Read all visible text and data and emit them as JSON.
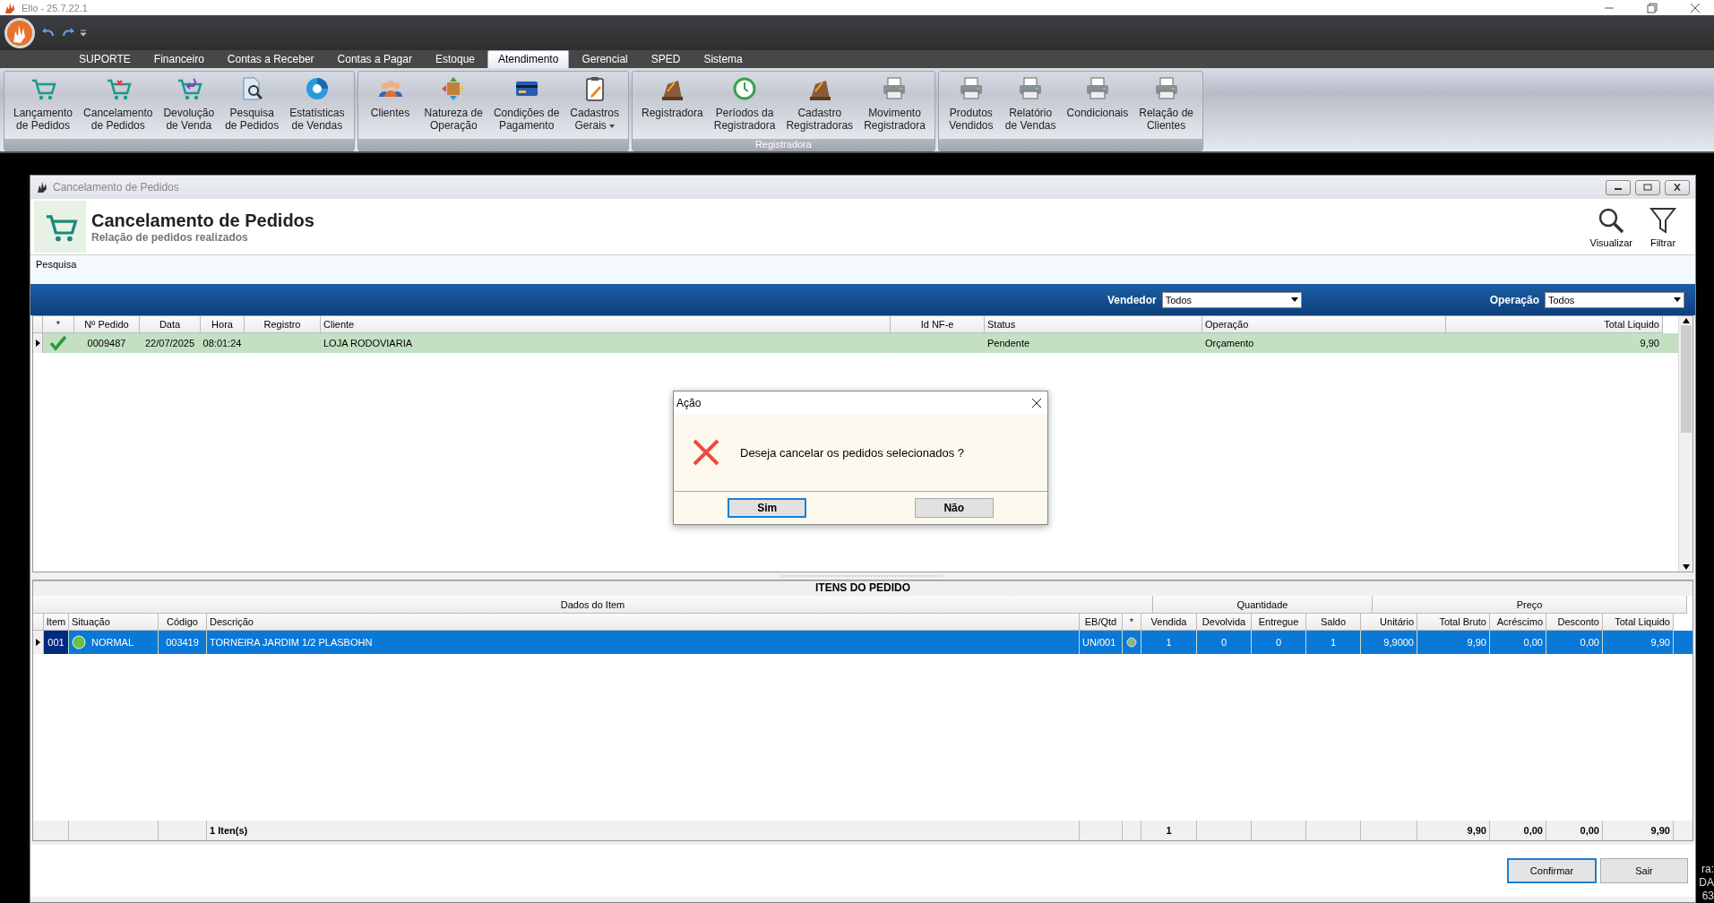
{
  "app_title": "Ello - 25.7.22.1",
  "ribbon_tabs": [
    {
      "label": "SUPORTE",
      "selected": false
    },
    {
      "label": "Financeiro",
      "selected": false
    },
    {
      "label": "Contas a Receber",
      "selected": false
    },
    {
      "label": "Contas a Pagar",
      "selected": false
    },
    {
      "label": "Estoque",
      "selected": false
    },
    {
      "label": "Atendimento",
      "selected": true
    },
    {
      "label": "Gerencial",
      "selected": false
    },
    {
      "label": "SPED",
      "selected": false
    },
    {
      "label": "Sistema",
      "selected": false
    }
  ],
  "ribbon_groups": [
    {
      "buttons": [
        {
          "label": "Lançamento\nde Pedidos"
        },
        {
          "label": "Cancelamento\nde Pedidos"
        },
        {
          "label": "Devolução\nde Venda"
        },
        {
          "label": "Pesquisa\nde Pedidos"
        },
        {
          "label": "Estatísticas\nde Vendas"
        }
      ]
    },
    {
      "buttons": [
        {
          "label": "Clientes"
        },
        {
          "label": "Natureza de\nOperação"
        },
        {
          "label": "Condições de\nPagamento"
        },
        {
          "label": "Cadastros\nGerais",
          "has_menu": true
        }
      ]
    },
    {
      "label": "Registradora",
      "buttons": [
        {
          "label": "Registradora"
        },
        {
          "label": "Períodos da\nRegistradora"
        },
        {
          "label": "Cadastro\nRegistradoras"
        },
        {
          "label": "Movimento\nRegistradora"
        }
      ]
    },
    {
      "buttons": [
        {
          "label": "Produtos\nVendidos"
        },
        {
          "label": "Relatório\nde Vendas"
        },
        {
          "label": "Condicionais"
        },
        {
          "label": "Relação de\nClientes"
        }
      ]
    }
  ],
  "window": {
    "title": "Cancelamento de Pedidos",
    "heading": "Cancelamento de Pedidos",
    "subheading": "Relação de pedidos realizados",
    "actions": [
      {
        "label": "Visualizar"
      },
      {
        "label": "Filtrar"
      }
    ]
  },
  "search_label": "Pesquisa",
  "filters": [
    {
      "label": "Vendedor",
      "value": "Todos"
    },
    {
      "label": "Operação",
      "value": "Todos"
    }
  ],
  "orders": {
    "columns": [
      "*",
      "Nº Pedido",
      "Data",
      "Hora",
      "Registro",
      "Cliente",
      "Id NF-e",
      "Status",
      "Operação",
      "Total Liquido"
    ],
    "rows": [
      {
        "selected": true,
        "checked": true,
        "cells": [
          "",
          "0009487",
          "22/07/2025",
          "08:01:24",
          "",
          "LOJA RODOVIARIA",
          "",
          "Pendente",
          "Orçamento",
          "9,90"
        ]
      }
    ]
  },
  "items": {
    "title": "ITENS DO PEDIDO",
    "groups": [
      "Dados do Item",
      "Quantidade",
      "Preço"
    ],
    "columns": [
      "Item",
      "Situação",
      "Código",
      "Descrição",
      "EB/Qtd",
      "*",
      "Vendida",
      "Devolvida",
      "Entregue",
      "Saldo",
      "Unitário",
      "Total Bruto",
      "Acréscimo",
      "Desconto",
      "Total Liquido"
    ],
    "rows": [
      {
        "selected": true,
        "cells": [
          "001",
          "NORMAL",
          "003419",
          "TORNEIRA JARDIM 1/2  PLASBOHN",
          "UN/001",
          "",
          "1",
          "0",
          "0",
          "1",
          "9,9000",
          "9,90",
          "0,00",
          "0,00",
          "9,90"
        ]
      }
    ],
    "footer": {
      "count": "1 Iten(s)",
      "vendida": "1",
      "total_bruto": "9,90",
      "acrescimo": "0,00",
      "desconto": "0,00",
      "total_liquido": "9,90"
    }
  },
  "buttons": [
    {
      "label": "Confirmar",
      "default": true
    },
    {
      "label": "Sair",
      "default": false
    }
  ],
  "dialog": {
    "title": "Ação",
    "message": "Deseja cancelar os pedidos selecionados ?",
    "buttons": [
      {
        "label": "Sim",
        "default": true
      },
      {
        "label": "Não",
        "default": false
      }
    ]
  },
  "desktop_fragments": [
    "ra:",
    "DA",
    "63"
  ]
}
